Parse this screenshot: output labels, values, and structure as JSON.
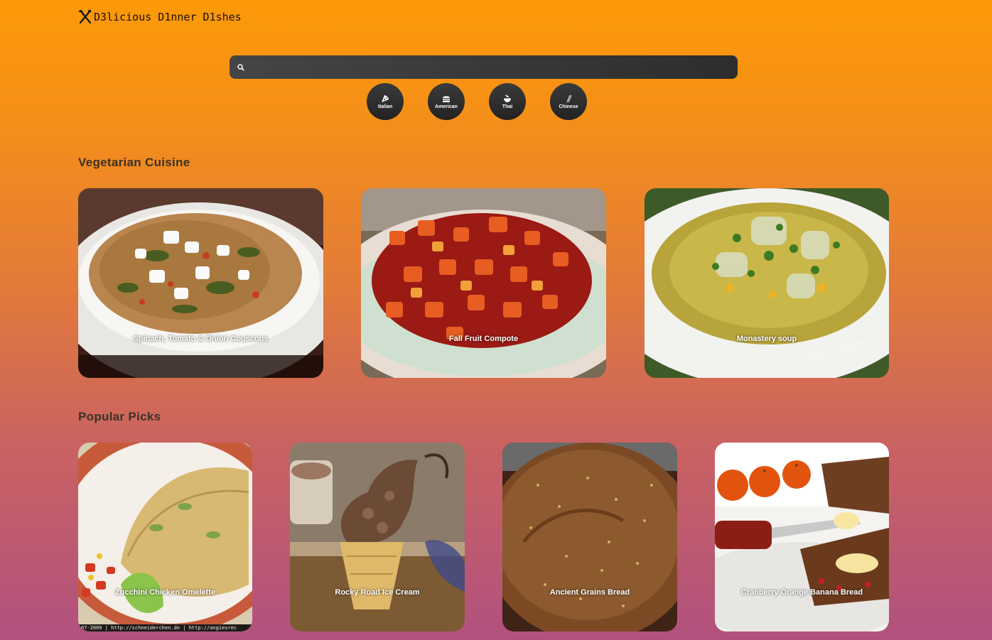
{
  "app": {
    "title": "D3licious D1nner D1shes",
    "logo_icon": "fork-knife-icon"
  },
  "search": {
    "placeholder": "",
    "value": "",
    "icon": "search-icon"
  },
  "cuisines": [
    {
      "label": "Italian",
      "icon": "pizza-icon"
    },
    {
      "label": "American",
      "icon": "burger-icon"
    },
    {
      "label": "Thai",
      "icon": "bowl-icon"
    },
    {
      "label": "Chinese",
      "icon": "chopsticks-icon"
    }
  ],
  "sections": {
    "vegetarian": {
      "title": "Vegetarian Cuisine",
      "items": [
        {
          "title": "Spinach, Tomato & Onion Couscous"
        },
        {
          "title": "Fall Fruit Compote"
        },
        {
          "title": "Monastery soup"
        }
      ]
    },
    "popular": {
      "title": "Popular Picks",
      "items": [
        {
          "title": "Zucchini Chicken Omelette"
        },
        {
          "title": "Rocky Road Ice Cream"
        },
        {
          "title": "Ancient Grains Bread"
        },
        {
          "title": "Cranberry Orange Banana Bread"
        }
      ]
    }
  },
  "image_watermarks": {
    "monastery_soup": "Laka kuharica",
    "omelette_credit": "07-2009 | http://schneiderchen.de | http://angiesrec"
  },
  "colors": {
    "bg_top": "#fc9a08",
    "bg_bottom": "#b1517f",
    "button_dark": "#2d2d2d"
  }
}
